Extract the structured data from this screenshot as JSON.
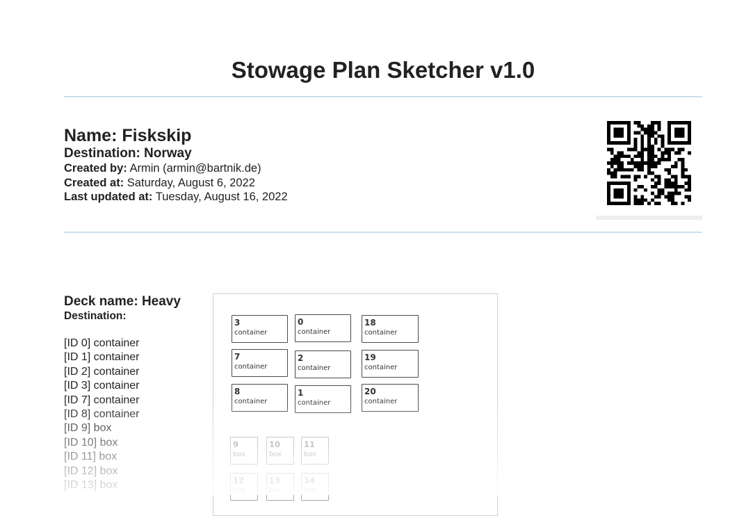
{
  "page": {
    "title": "Stowage Plan Sketcher v1.0"
  },
  "plan": {
    "name": "Name: Fiskskip",
    "destination": "Destination: Norway",
    "created_by_label": "Created by:",
    "created_by_value": "Armin (armin@bartnik.de)",
    "created_at_label": "Created at:",
    "created_at_value": "Saturday, August 6, 2022",
    "updated_at_label": "Last updated at:",
    "updated_at_value": "Tuesday, August 16, 2022"
  },
  "qr_code": {
    "icon": "qr-code-icon"
  },
  "deck": {
    "name": "Deck name: Heavy",
    "destination": "Destination:",
    "items": [
      "[ID 0] container",
      "[ID 1] container",
      "[ID 2] container",
      "[ID 3] container",
      "[ID 7] container",
      "[ID 8] container",
      "[ID 9] box",
      "[ID 10] box",
      "[ID 11] box",
      "[ID 12] box",
      "[ID 13] box"
    ]
  },
  "diagram": {
    "cells": [
      {
        "id": "3",
        "type": "container"
      },
      {
        "id": "0",
        "type": "container"
      },
      {
        "id": "18",
        "type": "container"
      },
      {
        "id": "7",
        "type": "container"
      },
      {
        "id": "2",
        "type": "container"
      },
      {
        "id": "19",
        "type": "container"
      },
      {
        "id": "8",
        "type": "container"
      },
      {
        "id": "1",
        "type": "container"
      },
      {
        "id": "20",
        "type": "container"
      },
      {
        "id": "9",
        "type": "box"
      },
      {
        "id": "10",
        "type": "box"
      },
      {
        "id": "11",
        "type": "box"
      },
      {
        "id": "12",
        "type": "box"
      },
      {
        "id": "13",
        "type": "box"
      },
      {
        "id": "14",
        "type": "box"
      }
    ]
  }
}
